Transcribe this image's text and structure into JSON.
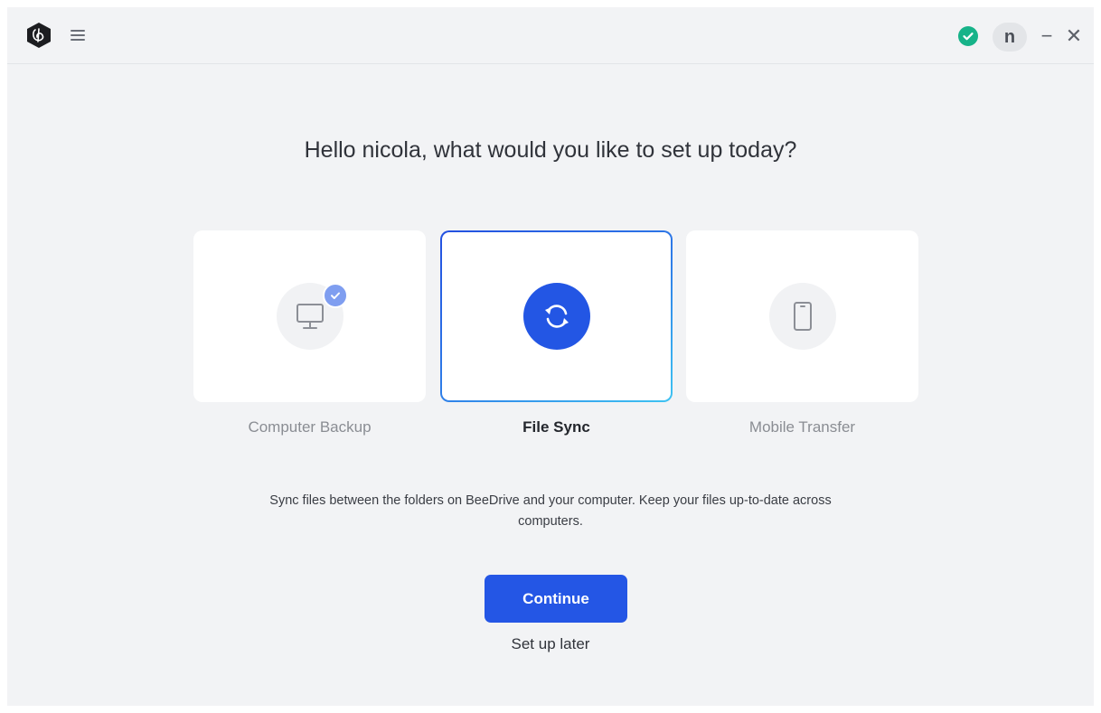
{
  "header": {
    "logo_icon": "beedrive-logo-icon",
    "menu_icon": "hamburger-menu-icon",
    "status_icon": "check-circle-icon",
    "status_color": "#17b389",
    "avatar_initial": "n",
    "minimize_symbol": "−",
    "close_symbol": "✕"
  },
  "main": {
    "heading": "Hello nicola, what would you like to set up today?",
    "options": [
      {
        "label": "Computer Backup",
        "icon": "monitor-icon",
        "badge": "check-icon",
        "selected": false
      },
      {
        "label": "File Sync",
        "icon": "sync-icon",
        "selected": true
      },
      {
        "label": "Mobile Transfer",
        "icon": "phone-icon",
        "selected": false
      }
    ],
    "description": "Sync files between the folders on BeeDrive and your computer. Keep your files up-to-date across computers.",
    "continue_label": "Continue",
    "later_label": "Set up later"
  },
  "colors": {
    "accent": "#2456e5",
    "background": "#f2f3f5",
    "card": "#ffffff"
  }
}
